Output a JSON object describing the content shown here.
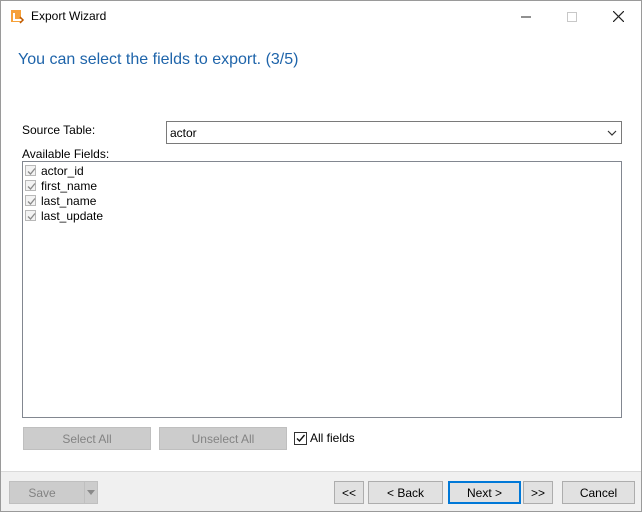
{
  "window": {
    "title": "Export Wizard",
    "icon": "export-wizard-app-icon",
    "controls": [
      "minimize-icon",
      "maximize-icon",
      "close-icon"
    ]
  },
  "header": {
    "text": "You can select the fields to export. (3/5)",
    "color": "#1e64aa"
  },
  "source": {
    "label": "Source Table:",
    "value": "actor"
  },
  "available": {
    "label": "Available Fields:",
    "fields": [
      {
        "name": "actor_id",
        "checked": true
      },
      {
        "name": "first_name",
        "checked": true
      },
      {
        "name": "last_name",
        "checked": true
      },
      {
        "name": "last_update",
        "checked": true
      }
    ]
  },
  "buttons": {
    "select_all": "Select All",
    "unselect_all": "Unselect All",
    "all_fields": "All fields",
    "all_fields_checked": true,
    "save": "Save",
    "first": "<<",
    "back": "< Back",
    "next": "Next >",
    "last": ">>",
    "cancel": "Cancel"
  }
}
